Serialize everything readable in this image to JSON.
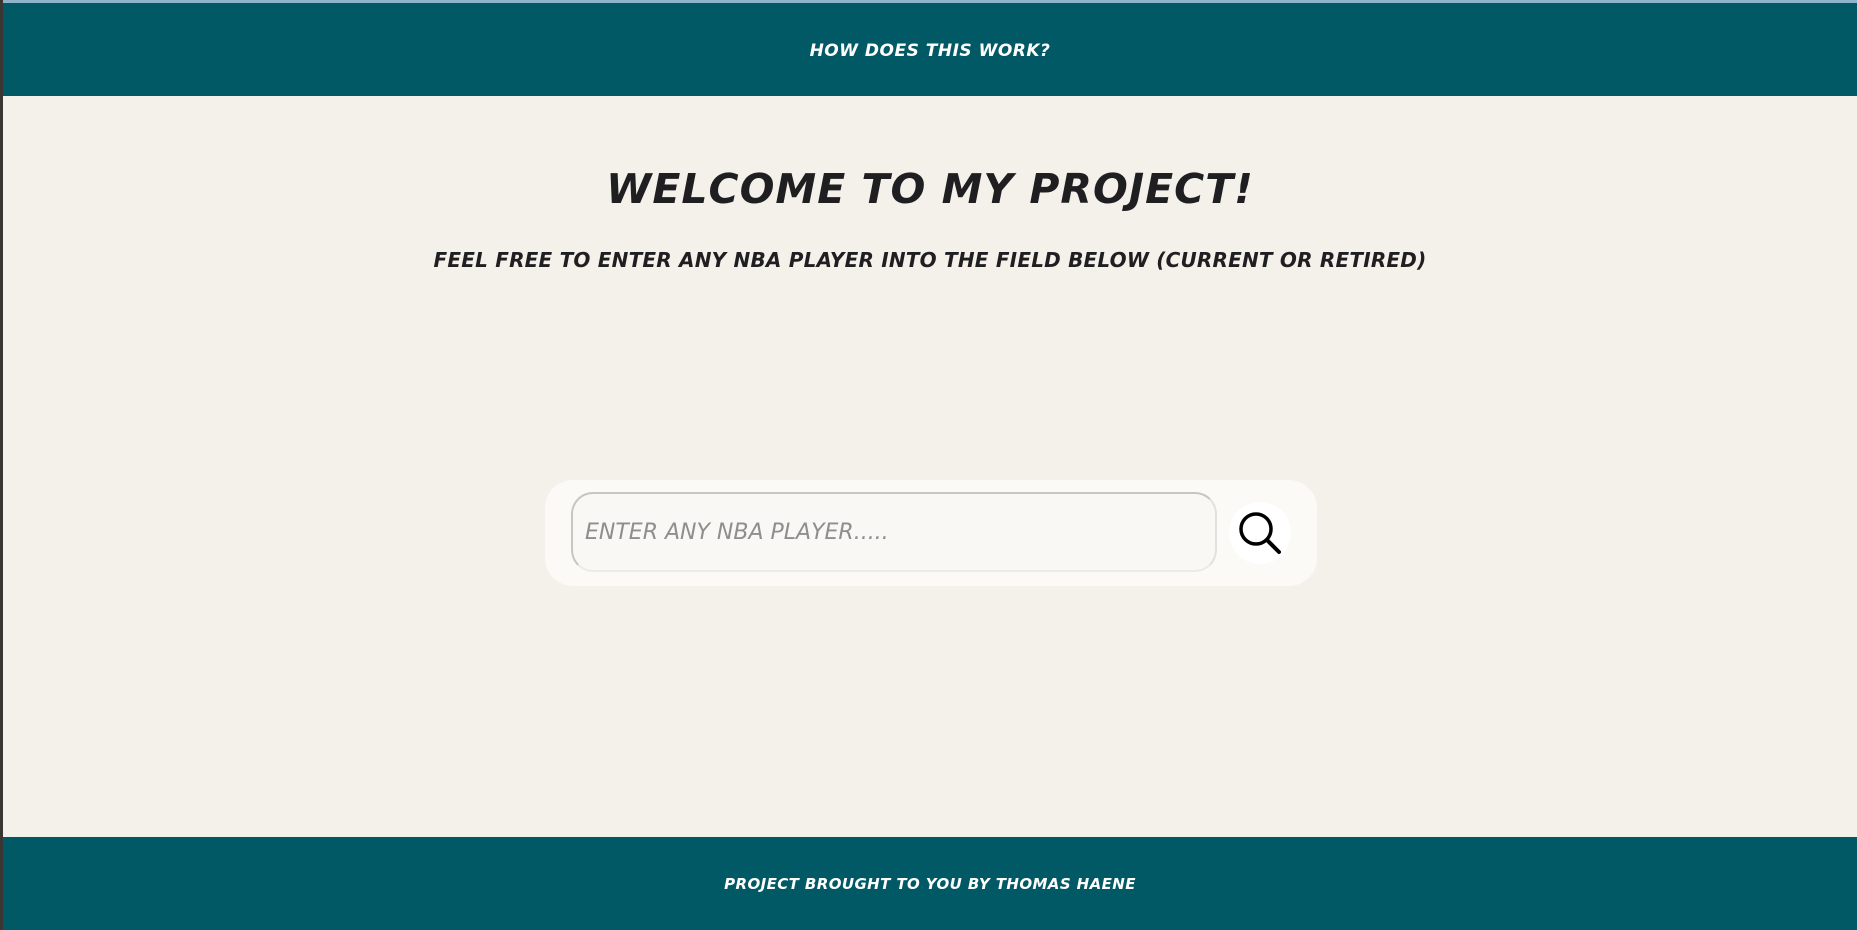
{
  "header": {
    "nav_link": "How does this work?"
  },
  "main": {
    "title": "Welcome to my project!",
    "subtitle": "Feel free to enter any NBA Player into the field below (Current or retired)"
  },
  "search": {
    "placeholder": "Enter any NBA player.....",
    "value": "",
    "button_icon": "search-icon"
  },
  "footer": {
    "text": "Project brought to you by Thomas Haene"
  },
  "colors": {
    "header_bg": "#015965",
    "page_bg": "#f4f1eb",
    "card_bg": "#fbfaf7",
    "text_dark": "#1f1f22",
    "text_light": "#ffffff"
  }
}
